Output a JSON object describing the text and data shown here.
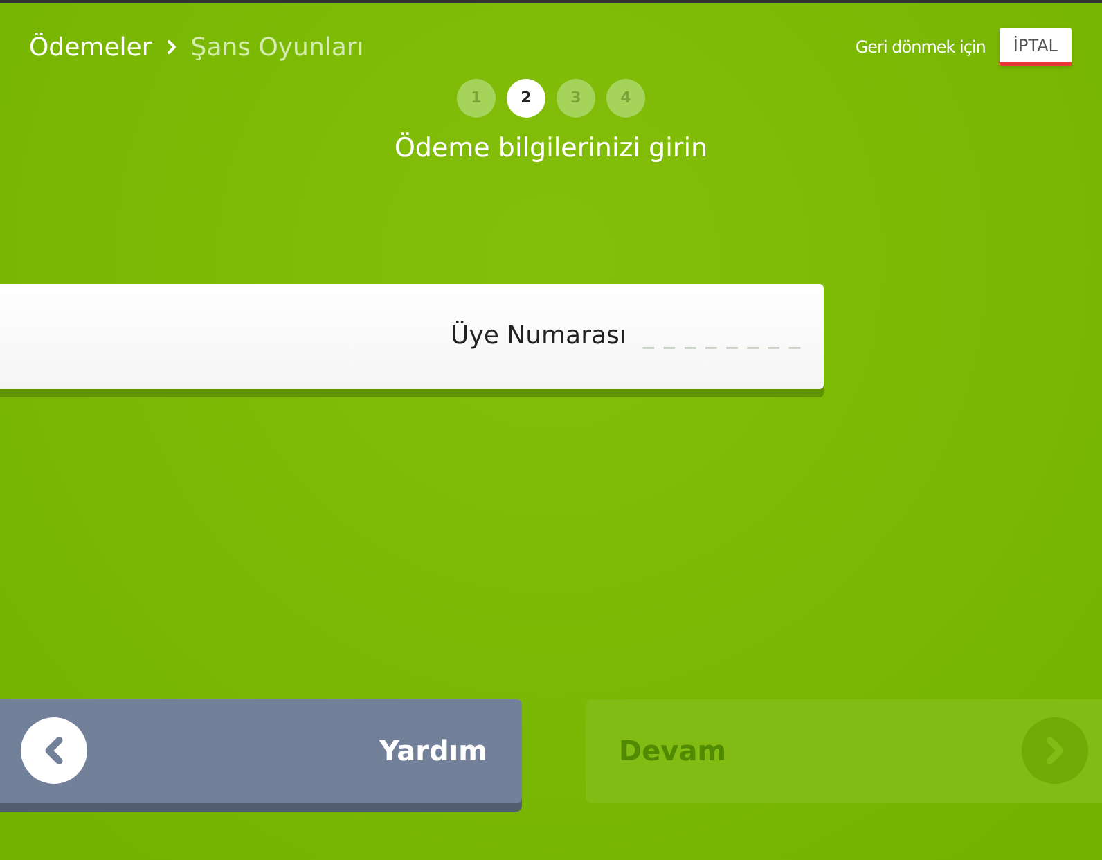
{
  "breadcrumb": [
    {
      "label": "Ödemeler",
      "selected": false
    },
    {
      "label": "Şans Oyunları",
      "selected": true
    }
  ],
  "cancel": {
    "hint": "Geri dönmek için",
    "label": "İPTAL"
  },
  "steps": [
    {
      "label": "1",
      "selected": false
    },
    {
      "label": "2",
      "selected": true
    },
    {
      "label": "3",
      "selected": false
    },
    {
      "label": "4",
      "selected": false
    }
  ],
  "title": "Ödeme bilgilerinizi girin",
  "field": {
    "label": "Üye Numarası",
    "placeholder": "_ _ _ _ _ _ _ _"
  },
  "buttons": [
    {
      "kind": "back",
      "label": "Yardım",
      "disabled": false
    },
    {
      "kind": "next",
      "label": "Devam",
      "disabled": true
    }
  ]
}
